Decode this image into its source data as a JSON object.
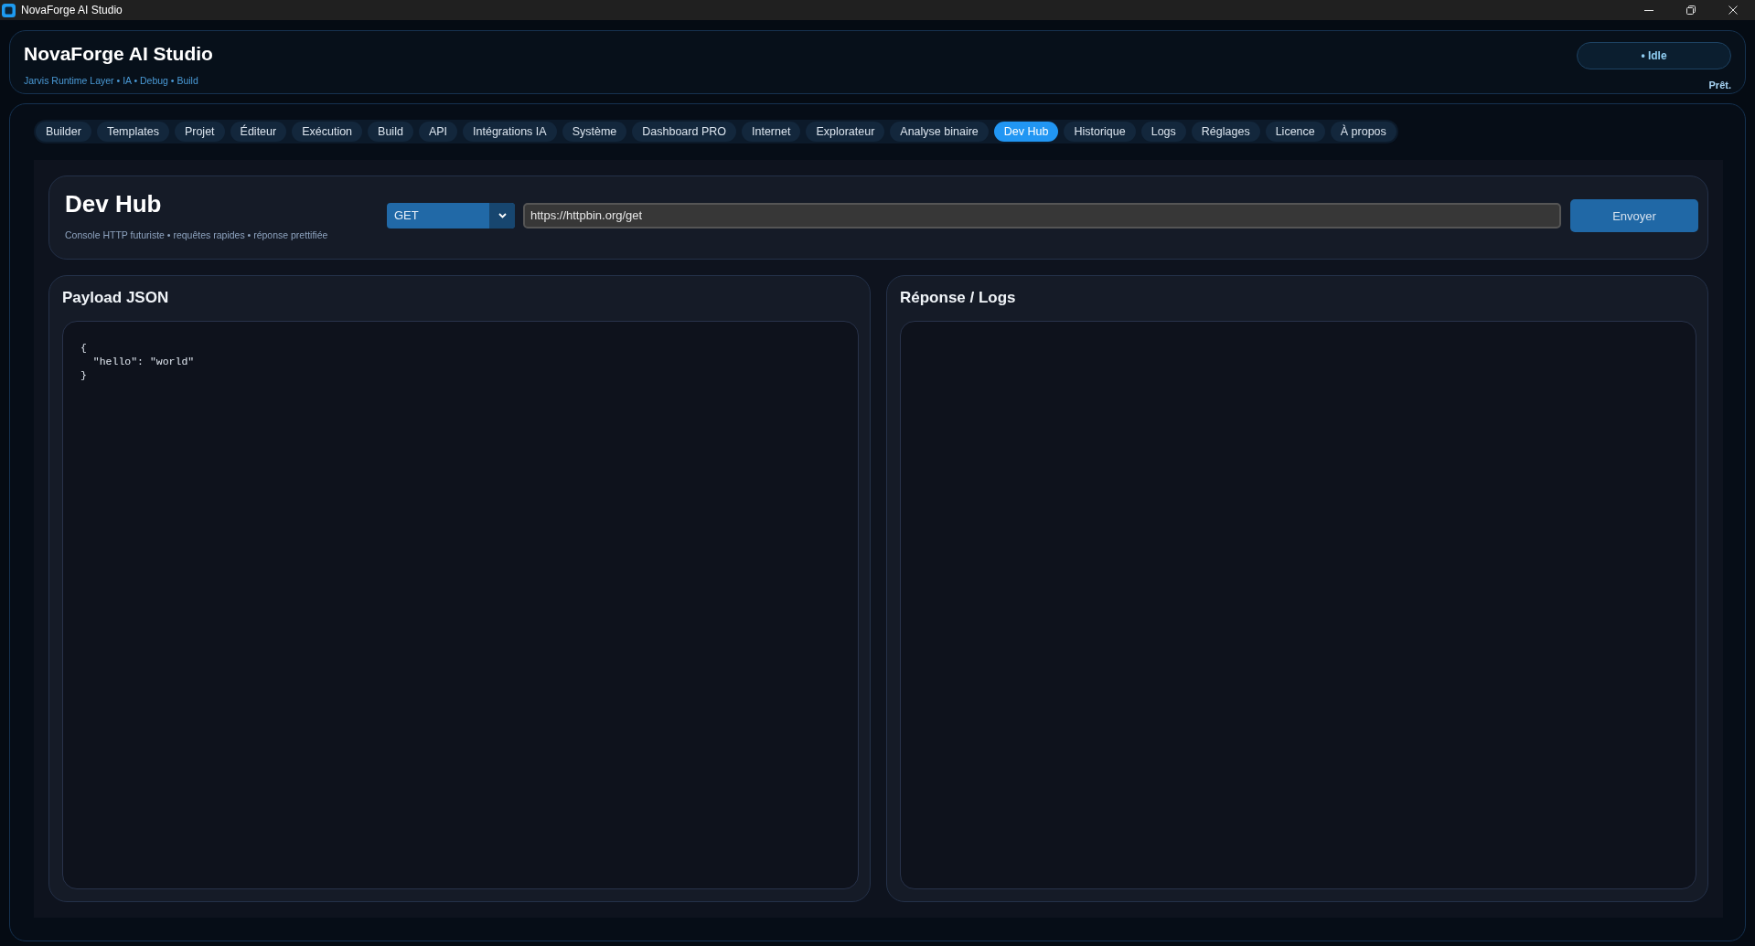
{
  "window": {
    "title": "NovaForge AI Studio"
  },
  "header": {
    "title": "NovaForge AI Studio",
    "subtitle": "Jarvis Runtime Layer • IA • Debug • Build",
    "status": "• Idle",
    "status_text": "Prêt."
  },
  "tabs": [
    {
      "label": "Builder",
      "selected": false
    },
    {
      "label": "Templates",
      "selected": false
    },
    {
      "label": "Projet",
      "selected": false
    },
    {
      "label": "Éditeur",
      "selected": false
    },
    {
      "label": "Exécution",
      "selected": false
    },
    {
      "label": "Build",
      "selected": false
    },
    {
      "label": "API",
      "selected": false
    },
    {
      "label": "Intégrations IA",
      "selected": false
    },
    {
      "label": "Système",
      "selected": false
    },
    {
      "label": "Dashboard PRO",
      "selected": false
    },
    {
      "label": "Internet",
      "selected": false
    },
    {
      "label": "Explorateur",
      "selected": false
    },
    {
      "label": "Analyse binaire",
      "selected": false
    },
    {
      "label": "Dev Hub",
      "selected": true
    },
    {
      "label": "Historique",
      "selected": false
    },
    {
      "label": "Logs",
      "selected": false
    },
    {
      "label": "Réglages",
      "selected": false
    },
    {
      "label": "Licence",
      "selected": false
    },
    {
      "label": "À propos",
      "selected": false
    }
  ],
  "dev_hub": {
    "title": "Dev Hub",
    "subtitle": "Console HTTP futuriste • requêtes rapides • réponse prettifiée",
    "method": "GET",
    "url": "https://httpbin.org/get",
    "send_button": "Envoyer"
  },
  "panels": [
    {
      "title": "Payload JSON",
      "value": "{\n  \"hello\": \"world\"\n}"
    },
    {
      "title": "Réponse / Logs"
    }
  ]
}
